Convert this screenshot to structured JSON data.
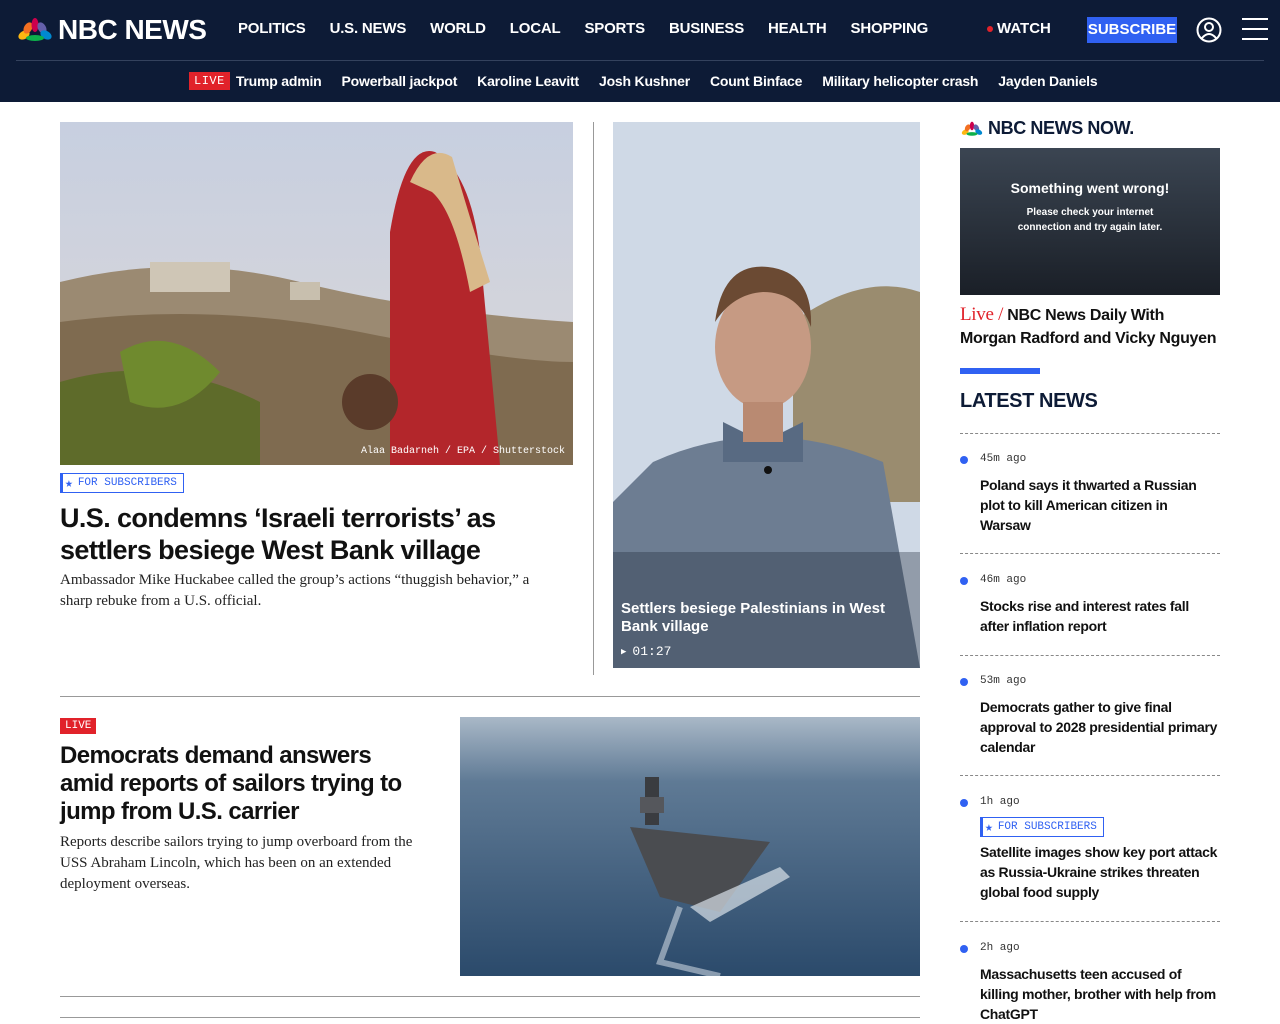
{
  "header": {
    "logo_text": "NBC NEWS",
    "nav": [
      "POLITICS",
      "U.S. NEWS",
      "WORLD",
      "LOCAL",
      "SPORTS",
      "BUSINESS",
      "HEALTH",
      "SHOPPING"
    ],
    "watch_label": "WATCH",
    "subscribe_label": "SUBSCRIBE",
    "trending_live_badge": "LIVE",
    "trending": [
      "Trump admin",
      "Powerball jackpot",
      "Karoline Leavitt",
      "Josh Kushner",
      "Count Binface",
      "Military helicopter crash",
      "Jayden Daniels"
    ]
  },
  "lead": {
    "photo_credit": "Alaa Badarneh / EPA / Shutterstock",
    "tag": "FOR SUBSCRIBERS",
    "headline": "U.S. condemns ‘Israeli terrorists’ as settlers besiege West Bank village",
    "dek": "Ambassador Mike Huckabee called the group’s actions “thuggish behavior,” a sharp rebuke from a U.S. official."
  },
  "video": {
    "title": "Settlers besiege Palestinians in West Bank village",
    "duration": "01:27"
  },
  "second": {
    "badge": "LIVE",
    "headline": "Democrats demand answers amid reports of sailors trying to jump from U.S. carrier",
    "dek": "Reports describe sailors trying to jump overboard from the USS Abraham Lincoln, which has been on an extended deployment overseas."
  },
  "rail": {
    "now_logo": "NBC NEWS NOW.",
    "error_title": "Something went wrong!",
    "error_line1": "Please check your internet",
    "error_line2": "connection and try again later.",
    "now_live": "Live /",
    "now_show": "NBC News Daily With Morgan Radford and Vicky Nguyen",
    "latest_heading": "LATEST NEWS",
    "items": [
      {
        "time": "45m ago",
        "headline": "Poland says it thwarted a Russian plot to kill American citizen in Warsaw"
      },
      {
        "time": "46m ago",
        "headline": "Stocks rise and interest rates fall after inflation report"
      },
      {
        "time": "53m ago",
        "headline": "Democrats gather to give final approval to 2028 presidential primary calendar"
      },
      {
        "time": "1h ago",
        "tag": "FOR SUBSCRIBERS",
        "headline": "Satellite images show key port attack as Russia-Ukraine strikes threaten global food supply"
      },
      {
        "time": "2h ago",
        "headline": "Massachusetts teen accused of killing mother, brother with help from ChatGPT"
      }
    ]
  },
  "colors": {
    "navy": "#0d1b36",
    "accent_blue": "#3061f2",
    "live_red": "#e1222a"
  }
}
